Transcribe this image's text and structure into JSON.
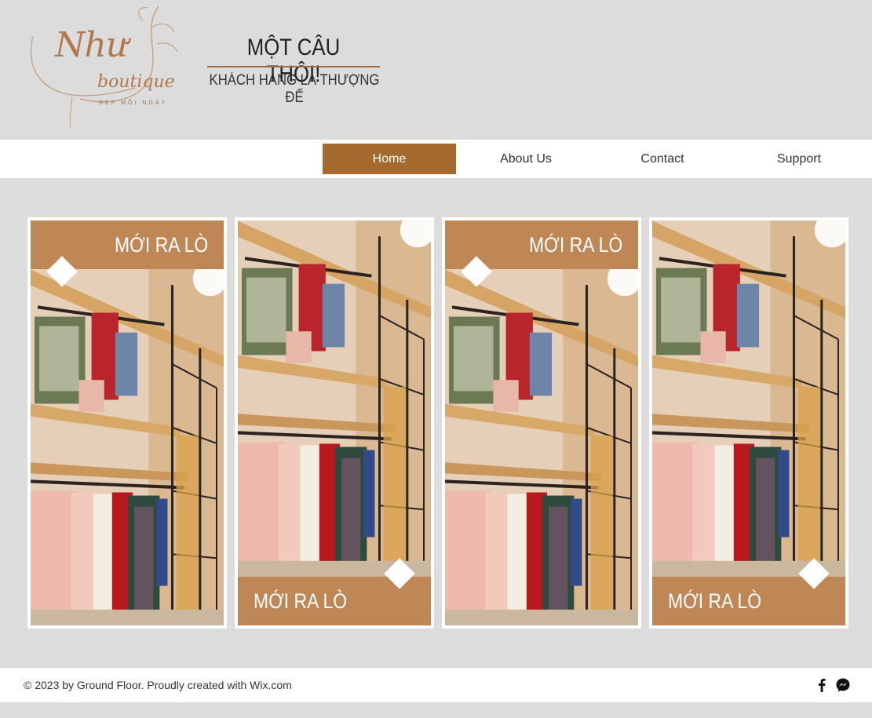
{
  "header": {
    "logo": {
      "main": "Như",
      "sub": "boutique",
      "tagline": "ĐẸP MỖI NGÀY"
    },
    "slogan": {
      "title": "MỘT CÂU THÔI!",
      "subtitle": "KHÁCH HÀNG LÀ THƯỢNG ĐẾ"
    }
  },
  "nav": {
    "items": [
      {
        "label": "Home",
        "active": true
      },
      {
        "label": "About Us",
        "active": false
      },
      {
        "label": "Contact",
        "active": false
      },
      {
        "label": "Support",
        "active": false
      }
    ]
  },
  "cards": [
    {
      "banner": "MỚI RA LÒ",
      "banner_position": "top"
    },
    {
      "banner": "MỚI RA LÒ",
      "banner_position": "bottom"
    },
    {
      "banner": "MỚI RA LÒ",
      "banner_position": "top"
    },
    {
      "banner": "MỚI RA LÒ",
      "banner_position": "bottom"
    }
  ],
  "footer": {
    "copyright": "© 2023 by Ground Floor. Proudly created with Wix.com",
    "social": [
      "facebook-icon",
      "messenger-icon"
    ]
  },
  "colors": {
    "accent": "#a4692f",
    "banner": "#bf8656",
    "background": "#dcdcdc"
  }
}
